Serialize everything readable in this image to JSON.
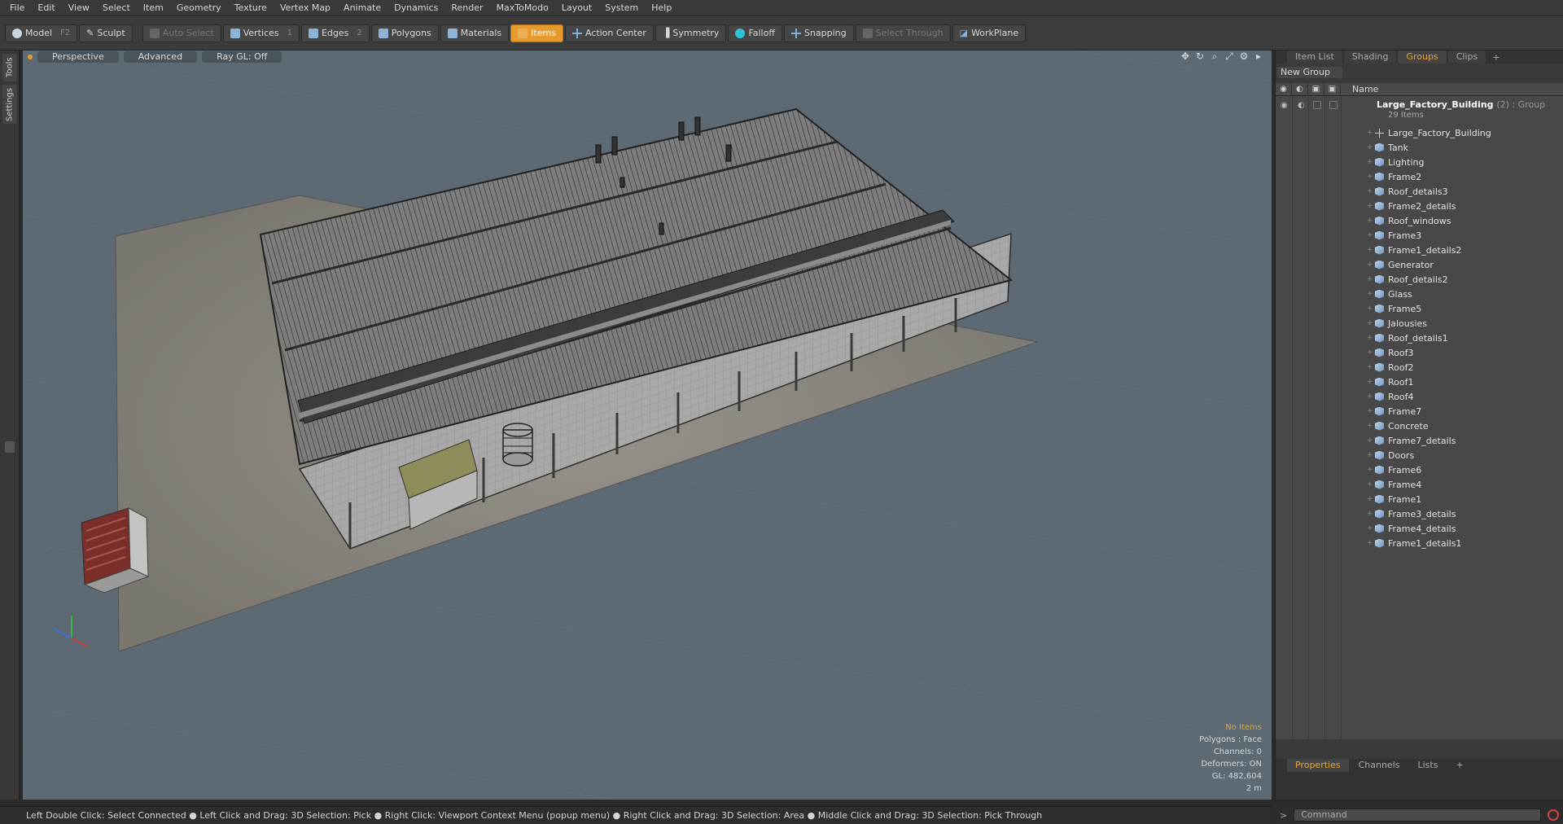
{
  "menu": [
    "File",
    "Edit",
    "View",
    "Select",
    "Item",
    "Geometry",
    "Texture",
    "Vertex Map",
    "Animate",
    "Dynamics",
    "Render",
    "MaxToModo",
    "Layout",
    "System",
    "Help"
  ],
  "toolbar": {
    "model": "Model",
    "model_key": "F2",
    "sculpt": "Sculpt",
    "auto_select": "Auto Select",
    "vertices": "Vertices",
    "vertices_key": "1",
    "edges": "Edges",
    "edges_key": "2",
    "polygons": "Polygons",
    "materials": "Materials",
    "items": "Items",
    "action_center": "Action Center",
    "symmetry": "Symmetry",
    "falloff": "Falloff",
    "snapping": "Snapping",
    "select_through": "Select Through",
    "workplane": "WorkPlane"
  },
  "left_tabs": [
    "Tools",
    "Settings"
  ],
  "viewport": {
    "view_mode": "Perspective",
    "shading": "Advanced",
    "raygl": "Ray GL: Off",
    "info": {
      "selection": "No Items",
      "polygons": "Polygons : Face",
      "channels": "Channels: 0",
      "deformers": "Deformers: ON",
      "gl": "GL: 482,604",
      "scale": "2 m"
    }
  },
  "right_panel": {
    "tabs": [
      "Item List",
      "Shading",
      "Groups",
      "Clips"
    ],
    "active_tab": "Groups",
    "new_group": "New Group",
    "column_name": "Name",
    "group": {
      "name": "Large_Factory_Building",
      "meta": "(2) : Group",
      "count": "29 Items"
    },
    "items": [
      "Large_Factory_Building",
      "Tank",
      "Lighting",
      "Frame2",
      "Roof_details3",
      "Frame2_details",
      "Roof_windows",
      "Frame3",
      "Frame1_details2",
      "Generator",
      "Roof_details2",
      "Glass",
      "Frame5",
      "Jalousies",
      "Roof_details1",
      "Roof3",
      "Roof2",
      "Roof1",
      "Roof4",
      "Frame7",
      "Concrete",
      "Frame7_details",
      "Doors",
      "Frame6",
      "Frame4",
      "Frame1",
      "Frame3_details",
      "Frame4_details",
      "Frame1_details1"
    ],
    "bottom_tabs": [
      "Properties",
      "Channels",
      "Lists"
    ]
  },
  "statusbar": {
    "text": "Left Double Click: Select Connected ● Left Click and Drag: 3D Selection: Pick ● Right Click: Viewport Context Menu (popup menu) ● Right Click and Drag: 3D Selection: Area ● Middle Click and Drag: 3D Selection: Pick Through"
  },
  "command": {
    "placeholder": "Command",
    "prompt": ">"
  },
  "colors": {
    "accent": "#e59a2b",
    "viewport_bg": "#5d6a73",
    "ground": "#8a877c",
    "roof": "#7a7a7a"
  }
}
